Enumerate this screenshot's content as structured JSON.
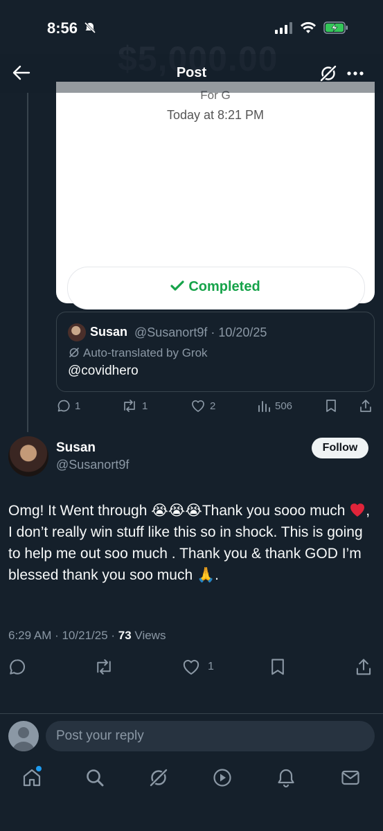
{
  "status_bar": {
    "time": "8:56"
  },
  "header": {
    "title": "Post"
  },
  "receipt": {
    "ghost_amount": "$5,000.00",
    "for_label": "For G",
    "date": "Today at 8:21 PM",
    "status": "Completed",
    "status_color": "#16a34a"
  },
  "quoted": {
    "name": "Susan",
    "handle_date": "@Susanort9f · 10/20/25",
    "translation": "Auto-translated by Grok",
    "text": "@covidhero"
  },
  "actions_quoted": {
    "replies": "1",
    "reposts": "1",
    "likes": "2",
    "views": "506"
  },
  "post": {
    "author_name": "Susan",
    "author_handle": "@Susanort9f",
    "follow_label": "Follow",
    "text_part1": "Omg! It Went through 😭😭😭Thank you sooo much ",
    "text_part2": ", I don’t really win stuff like this  so in shock. This is going to help me out soo much . Thank you & thank GOD I’m blessed thank you soo much 🙏.",
    "time_date": "6:29 AM · 10/21/25 · ",
    "views_count": "73",
    "views_label": " Views"
  },
  "actions_main": {
    "likes": "1"
  },
  "reply": {
    "placeholder": "Post your reply"
  },
  "nav": {
    "items": [
      "home-icon",
      "search-icon",
      "grok-icon",
      "video-icon",
      "notifications-icon",
      "messages-icon"
    ]
  },
  "colors": {
    "background": "#15202b",
    "accent": "#1d9bf0",
    "muted": "#8b98a5"
  }
}
